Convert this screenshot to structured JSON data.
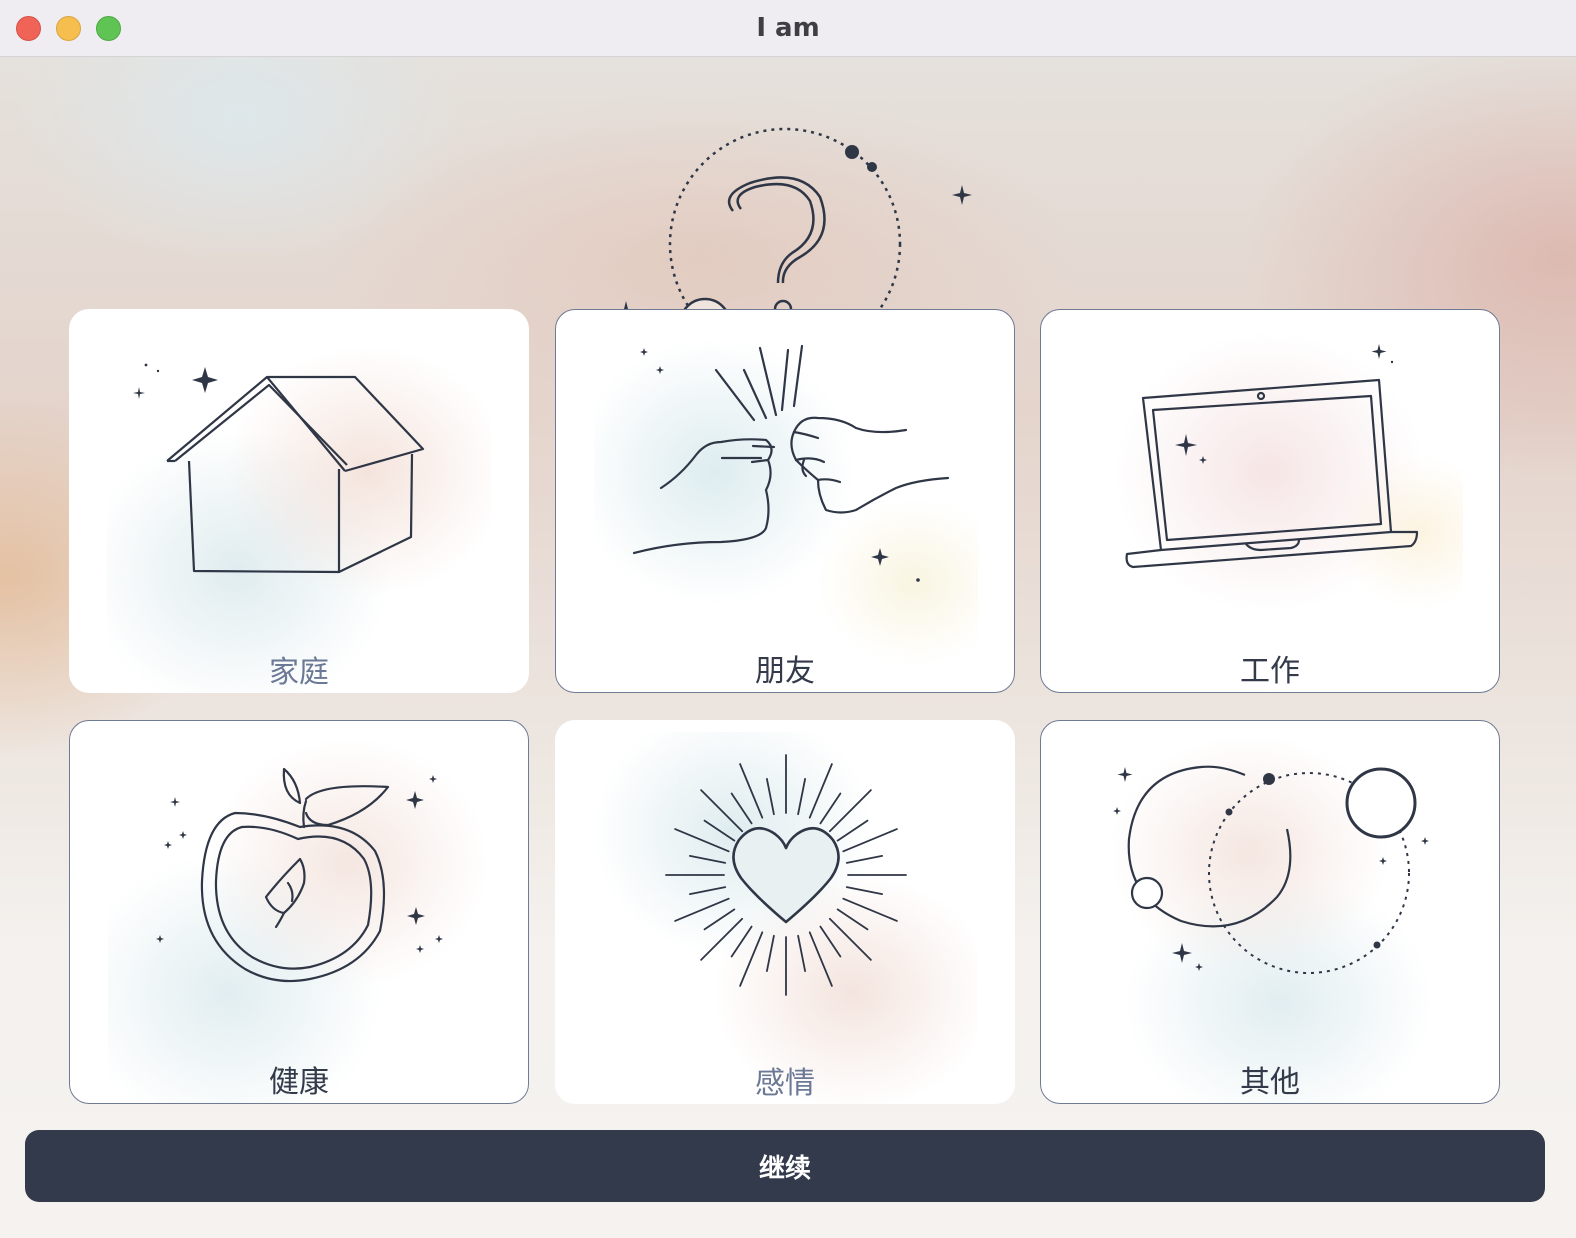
{
  "window": {
    "title": "I am",
    "controls": [
      "close",
      "minimize",
      "zoom"
    ]
  },
  "hero": {
    "icon": "question-mark-icon"
  },
  "categories": [
    {
      "label": "家庭",
      "icon": "house-icon"
    },
    {
      "label": "朋友",
      "icon": "fist-bump-icon"
    },
    {
      "label": "工作",
      "icon": "laptop-icon"
    },
    {
      "label": "健康",
      "icon": "apple-icon"
    },
    {
      "label": "感情",
      "icon": "heart-icon"
    },
    {
      "label": "其他",
      "icon": "orbit-icon"
    }
  ],
  "continue_label": "继续",
  "colors": {
    "accent": "#323a4c",
    "card_border": "#6f7a93",
    "label_text": "#333a4a",
    "muted_label_text": "#6b7896",
    "close": "#ef6457",
    "minimize": "#f5be4f",
    "zoom": "#5fc454"
  }
}
